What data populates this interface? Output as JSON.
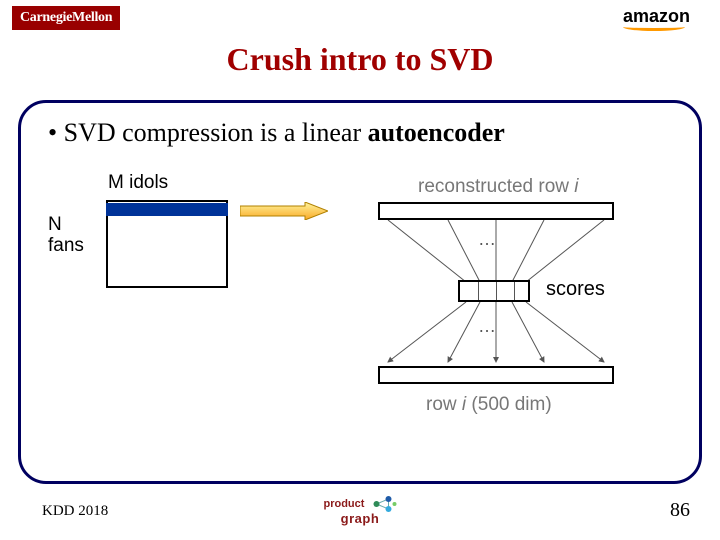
{
  "logos": {
    "cmu": "CarnegieMellon",
    "amazon": "amazon"
  },
  "title": "Crush intro to SVD",
  "bullet": {
    "prefix": "• SVD compression is a linear ",
    "bold": "autoencoder"
  },
  "diagram": {
    "m_label": "M idols",
    "n_label_line1": "N",
    "n_label_line2": "fans",
    "recon_prefix": "reconstructed row ",
    "recon_i": "i",
    "dots": "…",
    "scores": "scores",
    "row_prefix": "row ",
    "row_i": "i",
    "row_suffix": " (500 dim)"
  },
  "footer": {
    "left": "KDD 2018",
    "right": "86",
    "pg1": "product",
    "pg2": "graph"
  }
}
